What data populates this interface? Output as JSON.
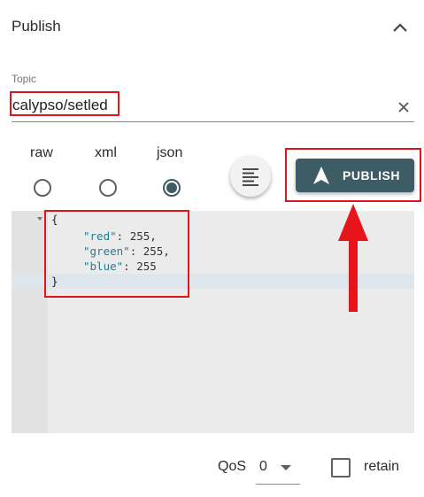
{
  "header": {
    "title": "Publish",
    "collapse_icon": "chevron-up-icon"
  },
  "topic": {
    "label": "Topic",
    "value": "calypso/setled",
    "clear_icon": "close-icon"
  },
  "formats": {
    "options": [
      "raw",
      "xml",
      "json"
    ],
    "selected": "json"
  },
  "format_button": {
    "icon": "format-align-icon"
  },
  "publish_button": {
    "label": "PUBLISH",
    "icon": "navigation-arrow-icon",
    "color": "#3d5c66"
  },
  "editor": {
    "lines": [
      "{",
      "\"red\": 255,",
      "\"green\": 255,",
      "\"blue\": 255",
      "}"
    ],
    "keys": [
      "\"red\"",
      "\"green\"",
      "\"blue\""
    ],
    "values": [
      "255",
      "255",
      "255"
    ]
  },
  "qos": {
    "label": "QoS",
    "value": "0"
  },
  "retain": {
    "label": "retain",
    "checked": false
  },
  "annotations": {
    "highlight_color": "#e0141b"
  }
}
